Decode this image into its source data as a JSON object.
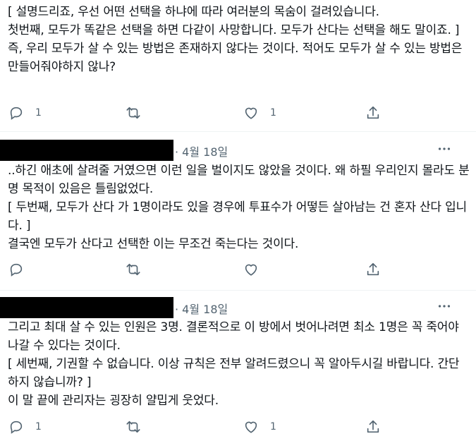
{
  "tweets": [
    {
      "author_redacted": false,
      "date": "",
      "text": "[ 설명드리죠, 우선 어떤 선택을 하냐에 따라 여러분의 목숨이 걸려있습니다.\n첫번째, 모두가 똑같은 선택을 하면 다같이 사망합니다. 모두가 산다는 선택을 해도 말이죠. ]\n즉, 우리 모두가 살 수 있는 방법은 존재하지 않다는 것이다. 적어도 모두가 살 수 있는 방법은 만들어줘야하지 않나?",
      "reply_count": "1",
      "like_count": "1"
    },
    {
      "author_redacted": true,
      "date": "· 4월 18일",
      "text": "..하긴 애초에 살려줄 거였으면 이런 일을 벌이지도 않았을 것이다. 왜 하필 우리인지 몰라도 분명 목적이 있음은 틀림없었다.\n [ 두번째, 모두가 산다 가 1명이라도 있을 경우에 투표수가 어떻든 살아남는 건 혼자 산다 입니다. ]\n결국엔 모두가 산다고 선택한 이는 무조건 죽는다는 것이다.",
      "reply_count": "",
      "like_count": ""
    },
    {
      "author_redacted": true,
      "date": "· 4월 18일",
      "text": "그리고 최대 살 수 있는 인원은 3명. 결론적으로 이 방에서 벗어나려면 최소 1명은 꼭 죽어야 나갈 수 있다는 것이다.\n [ 세번째, 기권할 수 없습니다. 이상 규칙은 전부 알려드렸으니 꼭 알아두시길 바랍니다. 간단하지 않습니까? ]\n이 말 끝에 관리자는 굉장히 얄밉게 웃었다.",
      "reply_count": "1",
      "like_count": "1"
    }
  ],
  "icons": {
    "reply": "reply-icon",
    "retweet": "retweet-icon",
    "like": "like-icon",
    "share": "share-icon",
    "more": "more-icon"
  },
  "colors": {
    "text": "#0f1419",
    "muted": "#536471",
    "divider": "#eff3f4"
  }
}
